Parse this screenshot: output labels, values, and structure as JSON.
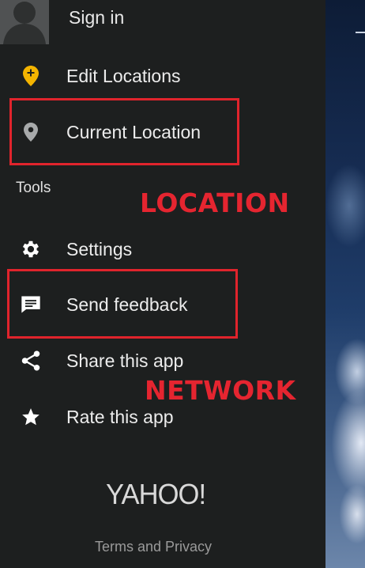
{
  "header": {
    "sign_in_label": "Sign in"
  },
  "menu": {
    "edit_locations": {
      "label": "Edit Locations",
      "icon": "pin-add-icon",
      "icon_color": "#f4b400"
    },
    "current_location": {
      "label": "Current Location",
      "icon": "location-pin-icon"
    }
  },
  "tools": {
    "header": "Tools",
    "items": [
      {
        "label": "Settings",
        "icon": "gear-icon"
      },
      {
        "label": "Send feedback",
        "icon": "feedback-icon"
      },
      {
        "label": "Share this app",
        "icon": "share-icon"
      },
      {
        "label": "Rate this app",
        "icon": "star-icon"
      }
    ]
  },
  "annotations": {
    "location": "LOCATION",
    "network": "NETWORK",
    "highlight_color": "#e0242c"
  },
  "footer": {
    "logo": "YAHOO!",
    "terms": "Terms and Privacy"
  }
}
